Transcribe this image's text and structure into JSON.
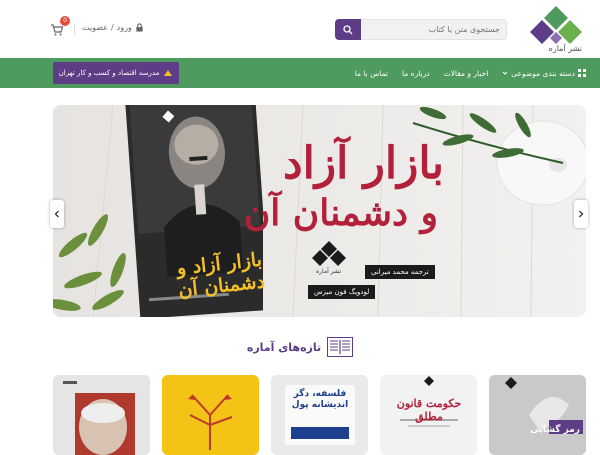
{
  "brand": {
    "logo_text": "نشر آماره",
    "colors": {
      "primary": "#5c3d86",
      "green": "#4e9a5f",
      "red": "#b3203a"
    }
  },
  "search": {
    "placeholder": "جستجوی متن یا کتاب",
    "icon": "search-icon"
  },
  "account": {
    "login_label": "ورود",
    "separator": "/",
    "register_label": "عضویت",
    "icon": "lock-icon"
  },
  "cart": {
    "count": "0",
    "icon": "cart-icon"
  },
  "nav": {
    "items": [
      {
        "label": "دسته بندی موضوعی",
        "icon": "grid-icon",
        "has_dropdown": true
      },
      {
        "label": "اخبار و مقالات"
      },
      {
        "label": "درباره ما"
      },
      {
        "label": "تماس با ما"
      }
    ],
    "school_button": "مدرسه اقتصاد و کسب و کار تهران"
  },
  "hero": {
    "title_line1": "بازار آزاد",
    "title_line2": "و دشمنان آن",
    "translator": "ترجمه محمد میرانی",
    "author": "لودویگ فون میزس",
    "publisher": "نشر آماره",
    "book_cover_title": "بازار آزاد و دشمنان آن"
  },
  "section": {
    "title": "تازه‌های آماره",
    "icon": "book-open-icon"
  },
  "new_books": [
    {
      "title": "رمز گشایی",
      "bg": "#c9c9c9"
    },
    {
      "title": "حکومت قانون مطلق",
      "bg": "#f2f2f2"
    },
    {
      "title": "فلسفه، دگر اندیشانه پول",
      "bg": "#eaeaea"
    },
    {
      "title": "",
      "bg": "#f3c416"
    },
    {
      "title": "",
      "bg": "#e5e5e5"
    }
  ]
}
